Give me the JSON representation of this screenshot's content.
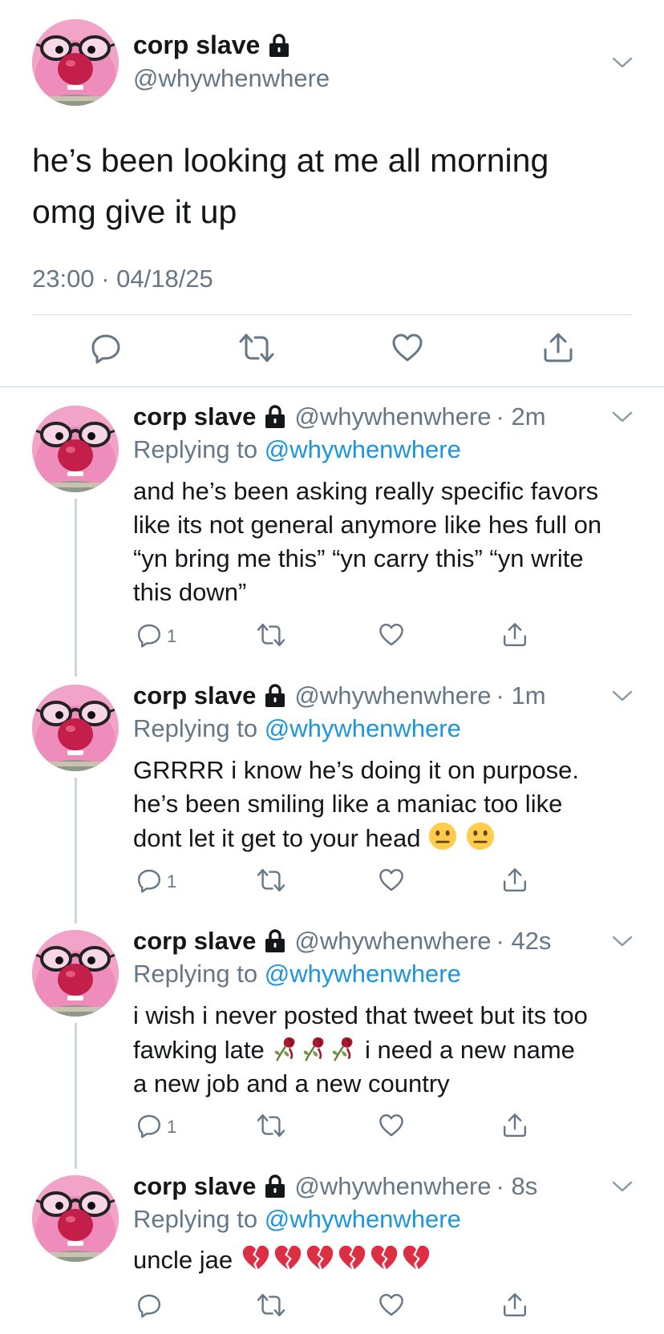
{
  "main_tweet": {
    "display_name": "corp slave",
    "handle": "@whywhenwhere",
    "text_line1": "he’s been looking at me all morning",
    "text_line2": "omg give it up",
    "timestamp": "23:00 · 04/18/25",
    "icons": [
      "lock-icon",
      "chevron-down-icon",
      "reply-icon",
      "retweet-icon",
      "like-icon",
      "share-icon"
    ]
  },
  "replies": [
    {
      "display_name": "corp slave",
      "handle": "@whywhenwhere",
      "time": "· 2m",
      "replying_prefix": "Replying to ",
      "replying_to": "@whywhenwhere",
      "lines": [
        "and he’s been asking really specific favors",
        "like its not general anymore like hes full on",
        "“yn bring me this” “yn carry this” “yn write",
        "this down”"
      ],
      "reply_count": "1"
    },
    {
      "display_name": "corp slave",
      "handle": "@whywhenwhere",
      "time": "· 1m",
      "replying_prefix": "Replying to ",
      "replying_to": "@whywhenwhere",
      "lines": [
        "GRRRR i know he’s doing it on purpose.",
        "he’s been smiling like a maniac too like",
        "dont let it get to your head"
      ],
      "emojis": [
        "neutral-face-icon",
        "neutral-face-icon"
      ],
      "reply_count": "1"
    },
    {
      "display_name": "corp slave",
      "handle": "@whywhenwhere",
      "time": "· 42s",
      "replying_prefix": "Replying to ",
      "replying_to": "@whywhenwhere",
      "lines": [
        "i wish i never posted that tweet but its too",
        "fawking late",
        "i need a new name",
        "a new job and a new country"
      ],
      "emojis": [
        "wilted-rose-icon",
        "wilted-rose-icon",
        "wilted-rose-icon"
      ],
      "reply_count": "1"
    },
    {
      "display_name": "corp slave",
      "handle": "@whywhenwhere",
      "time": "· 8s",
      "replying_prefix": "Replying to ",
      "replying_to": "@whywhenwhere",
      "lines": [
        "uncle jae"
      ],
      "emojis": [
        "broken-heart-icon",
        "broken-heart-icon",
        "broken-heart-icon",
        "broken-heart-icon",
        "broken-heart-icon",
        "broken-heart-icon"
      ]
    }
  ],
  "colors": {
    "text": "#14171a",
    "muted": "#657786",
    "link": "#1b95e0",
    "divider": "#ccd6dd",
    "thread_line": "#ccd6dd"
  }
}
